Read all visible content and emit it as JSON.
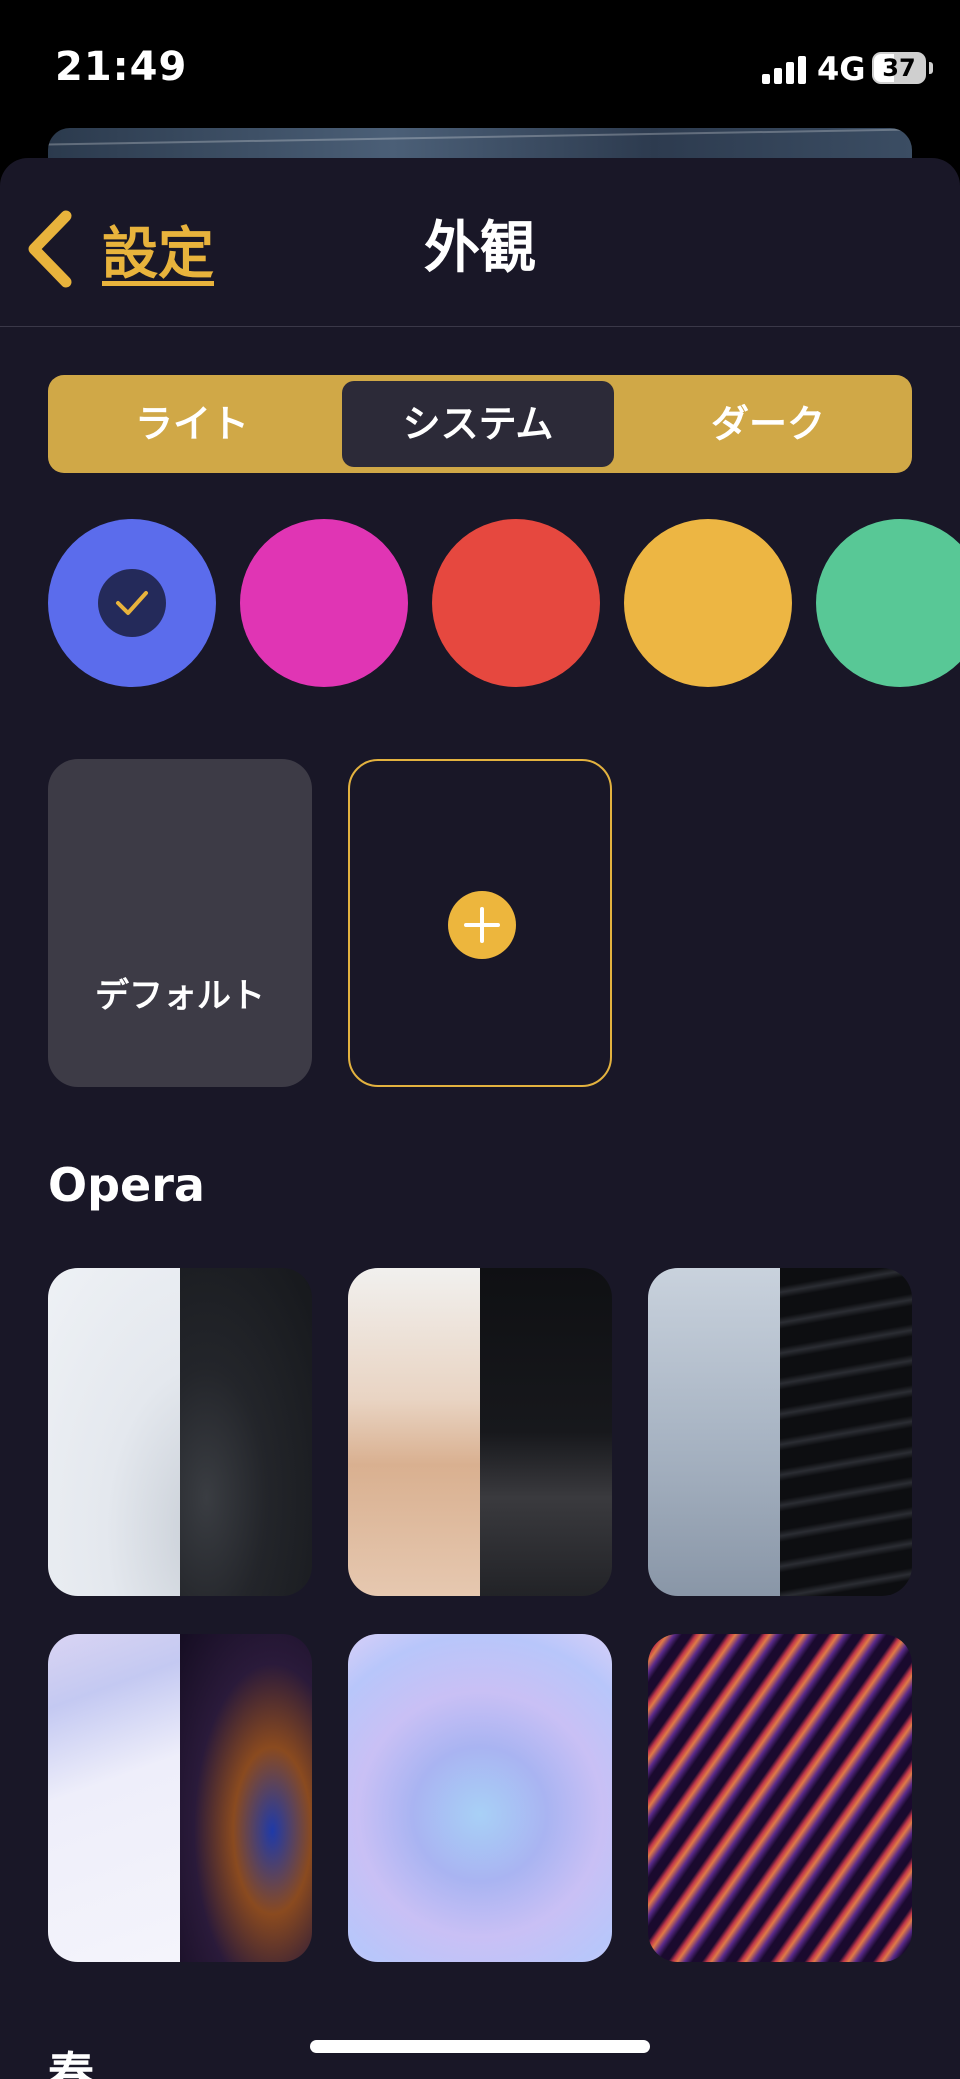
{
  "status": {
    "time": "21:49",
    "network": "4G",
    "battery": "37"
  },
  "nav": {
    "back_label": "設定",
    "title": "外観"
  },
  "segments": {
    "light": "ライト",
    "system": "システム",
    "dark": "ダーク",
    "selected": "システム"
  },
  "accent_colors": [
    "#5b6cec",
    "#e035b4",
    "#e6483f",
    "#edb643",
    "#58c896"
  ],
  "selected_accent": "#5b6cec",
  "backgrounds": {
    "default_label": "デフォルト",
    "add_icon": "plus-icon"
  },
  "sections": {
    "opera": "Opera",
    "spring": "春"
  }
}
